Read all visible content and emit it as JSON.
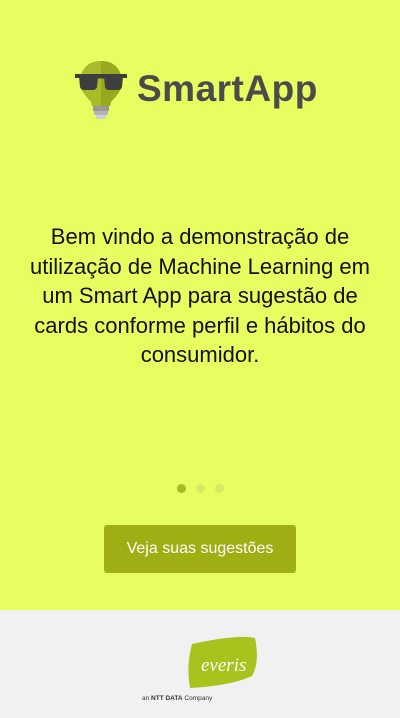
{
  "header": {
    "app_name": "SmartApp"
  },
  "onboarding": {
    "welcome_text": "Bem vindo a demonstração de utilização de Machine Learning em um Smart App para sugestão de cards conforme perfil e hábitos do consumidor.",
    "page_indicator": {
      "current": 1,
      "total": 3
    },
    "cta_label": "Veja suas sugestões"
  },
  "footer": {
    "brand": "everis",
    "tagline_prefix": "an",
    "tagline_company": "NTT DATA",
    "tagline_suffix": "Company"
  },
  "colors": {
    "background": "#e8fd5f",
    "button": "#9fae13",
    "footer_bg": "#f1f1f1",
    "brand_green": "#a8c21e"
  }
}
